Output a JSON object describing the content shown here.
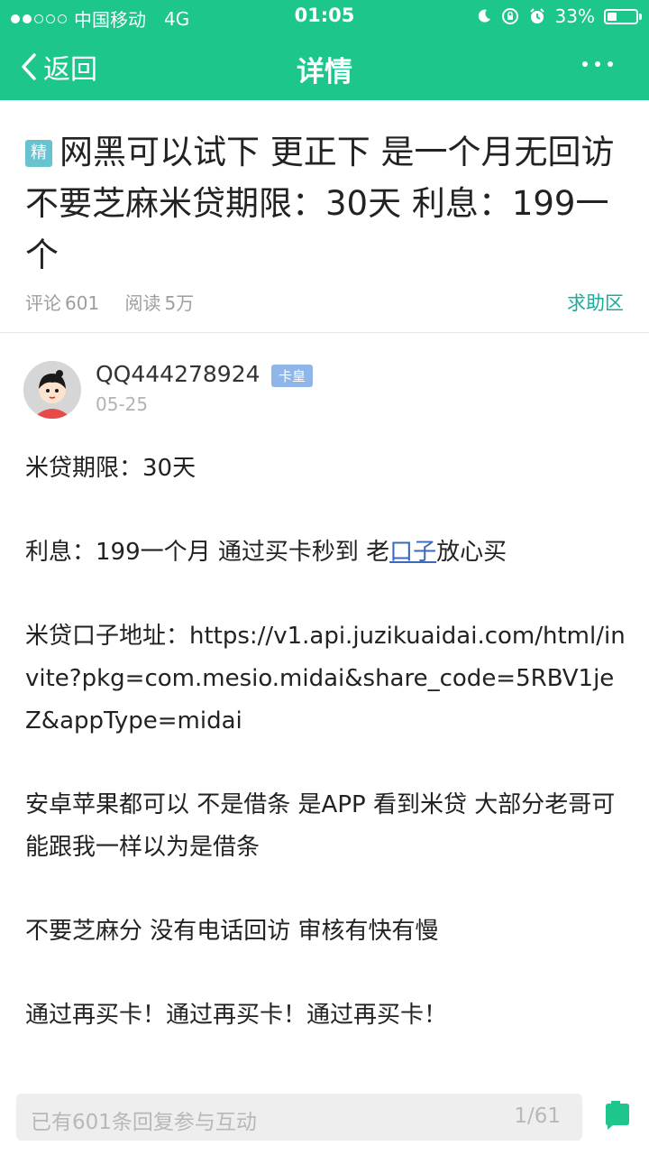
{
  "status_bar": {
    "carrier": "中国移动",
    "network": "4G",
    "time": "01:05",
    "battery_percent": "33%",
    "battery_level": 0.33
  },
  "nav": {
    "back_label": "返回",
    "title": "详情"
  },
  "post": {
    "badge": "精",
    "title": "网黑可以试下 更正下 是一个月无回访不要芝麻米贷期限：30天 利息：199一个",
    "comments_label": "评论",
    "comments_count": "601",
    "views_label": "阅读",
    "views_count": "5万",
    "section": "求助区"
  },
  "author": {
    "name": "QQ444278924",
    "rank": "卡皇",
    "date": "05-25"
  },
  "body": {
    "p1": "米贷期限：30天",
    "p2_before": "利息：199一个月 通过买卡秒到 老",
    "p2_link": "口子",
    "p2_after": "放心买",
    "p3": "米贷口子地址：https://v1.api.juzikuaidai.com/html/invite?pkg=com.mesio.midai&share_code=5RBV1jeZ&appType=midai",
    "p4": "安卓苹果都可以 不是借条 是APP 看到米贷 大部分老哥可能跟我一样以为是借条",
    "p5": "不要芝麻分 没有电话回访 审核有快有慢",
    "p6": "通过再买卡！通过再买卡！通过再买卡！"
  },
  "reply_bar": {
    "placeholder": "已有601条回复参与互动",
    "page": "1/61"
  },
  "colors": {
    "brand": "#1dc68b",
    "section_link": "#1aad9a",
    "badge": "#69c3cf",
    "rank_badge": "#8fb6e8",
    "link": "#3b6bb8"
  },
  "icons": {
    "back": "chevron-left-icon",
    "more": "more-dots-icon",
    "moon": "moon-icon",
    "lock": "rotation-lock-icon",
    "alarm": "alarm-icon",
    "battery": "battery-icon",
    "comment": "comment-icon"
  }
}
